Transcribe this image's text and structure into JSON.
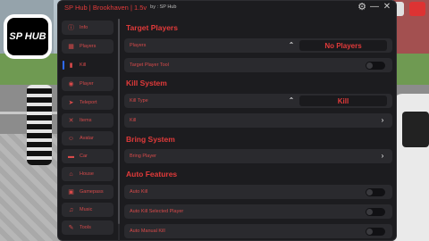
{
  "app": {
    "title": "SP Hub | Brookhaven | 1.5v",
    "by": "by : SP Hub",
    "logo_text": "SP HUB"
  },
  "sidebar": {
    "items": [
      {
        "label": "Info",
        "icon": "info-icon",
        "glyph": "ⓘ"
      },
      {
        "label": "Players",
        "icon": "players-icon",
        "glyph": "▦"
      },
      {
        "label": "Kill",
        "icon": "kill-icon",
        "glyph": "▮",
        "active": true
      },
      {
        "label": "Player",
        "icon": "player-icon",
        "glyph": "◉"
      },
      {
        "label": "Teleport",
        "icon": "teleport-icon",
        "glyph": "➤"
      },
      {
        "label": "Items",
        "icon": "items-icon",
        "glyph": "✕"
      },
      {
        "label": "Avatar",
        "icon": "avatar-icon",
        "glyph": "☺"
      },
      {
        "label": "Car",
        "icon": "car-icon",
        "glyph": "▬"
      },
      {
        "label": "House",
        "icon": "house-icon",
        "glyph": "⌂"
      },
      {
        "label": "Gamepass",
        "icon": "gamepass-icon",
        "glyph": "▣"
      },
      {
        "label": "Music",
        "icon": "music-icon",
        "glyph": "♫"
      },
      {
        "label": "Tools",
        "icon": "tools-icon",
        "glyph": "✎"
      }
    ]
  },
  "sections": {
    "target": {
      "title": "Target Players",
      "players_label": "Players",
      "players_value": "No Players",
      "tool_label": "Target Player Tool"
    },
    "kill": {
      "title": "Kill System",
      "type_label": "Kill Type",
      "type_value": "Kill",
      "kill_label": "Kill"
    },
    "bring": {
      "title": "Bring System",
      "bring_label": "Bring Player"
    },
    "auto": {
      "title": "Auto Features",
      "auto_kill_label": "Auto Kill",
      "auto_kill_selected_label": "Auto Kill Selected Player",
      "auto_manual_kill_label": "Auto Manual Kill"
    }
  },
  "colors": {
    "accent": "#e23a3a",
    "panel": "#1c1c1f",
    "row": "#2a2a2e",
    "active_indicator": "#2f6bff"
  }
}
